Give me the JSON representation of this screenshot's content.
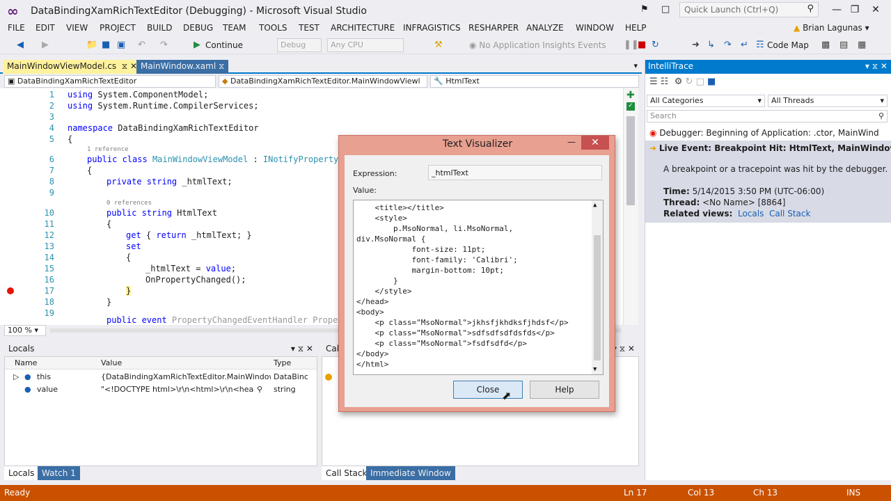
{
  "window": {
    "title": "DataBindingXamRichTextEditor (Debugging) - Microsoft Visual Studio",
    "quick_launch_placeholder": "Quick Launch (Ctrl+Q)"
  },
  "menu": [
    "FILE",
    "EDIT",
    "VIEW",
    "PROJECT",
    "BUILD",
    "DEBUG",
    "TEAM",
    "TOOLS",
    "TEST",
    "ARCHITECTURE",
    "INFRAGISTICS",
    "RESHARPER",
    "ANALYZE",
    "WINDOW",
    "HELP"
  ],
  "user": "Brian Lagunas",
  "toolbar": {
    "continue_label": "Continue",
    "config": "Debug",
    "platform": "Any CPU",
    "insights": "No Application Insights Events",
    "code_map": "Code Map"
  },
  "tabs": {
    "active": "MainWindowViewModel.cs",
    "inactive": "MainWindow.xaml"
  },
  "nav": {
    "project": "DataBindingXamRichTextEditor",
    "type": "DataBindingXamRichTextEditor.MainWindowViewl",
    "member": "HtmlText"
  },
  "editor": {
    "zoom": "100 %",
    "line_numbers": [
      "1",
      "2",
      "3",
      "4",
      "5",
      "6",
      "7",
      "8",
      "9",
      "10",
      "11",
      "12",
      "13",
      "14",
      "15",
      "16",
      "17",
      "18",
      "19"
    ],
    "refs_1": "1 reference",
    "refs_0": "0 references"
  },
  "locals": {
    "title": "Locals",
    "headers": [
      "Name",
      "Value",
      "Type"
    ],
    "rows": [
      {
        "name": "this",
        "value": "{DataBindingXamRichTextEditor.MainWindow",
        "type": "DataBinc"
      },
      {
        "name": "value",
        "value": "\"<!DOCTYPE html>\\r\\n<html>\\r\\n<heac",
        "type": "string"
      }
    ],
    "tab_locals": "Locals",
    "tab_watch": "Watch 1"
  },
  "callstack": {
    "title": "Call",
    "tab_callstack": "Call Stack",
    "tab_immediate": "Immediate Window"
  },
  "intellitrace": {
    "title": "IntelliTrace",
    "categories": "All Categories",
    "threads": "All Threads",
    "search_placeholder": "Search",
    "event1": "Debugger: Beginning of Application: .ctor, MainWind",
    "event2": "Live Event: Breakpoint Hit: HtmlText, MainWindowVie",
    "event2_desc": "A breakpoint or a tracepoint was hit by the debugger.",
    "time_label": "Time:",
    "time_value": "5/14/2015 3:50 PM (UTC-06:00)",
    "thread_label": "Thread:",
    "thread_value": "<No Name> [8864]",
    "related_label": "Related views:",
    "related_locals": "Locals",
    "related_callstack": "Call Stack"
  },
  "dialog": {
    "title": "Text Visualizer",
    "expression_label": "Expression:",
    "expression_value": "_htmlText",
    "value_label": "Value:",
    "lines": [
      "    <title></title>",
      "    <style>",
      "        p.MsoNormal, li.MsoNormal,",
      "div.MsoNormal {",
      "            font-size: 11pt;",
      "            font-family: 'Calibri';",
      "            margin-bottom: 10pt;",
      "        }",
      "    </style>",
      "</head>",
      "<body>",
      "    <p class=\"MsoNormal\">jkhsfjkhdksfjhdsf</p>",
      "    <p class=\"MsoNormal\">sdfsdfsdfdsfds</p>",
      "    <p class=\"MsoNormal\">fsdfsdfd</p>",
      "</body>",
      "</html>"
    ],
    "close_label": "Close",
    "help_label": "Help"
  },
  "status": {
    "ready": "Ready",
    "ln": "Ln 17",
    "col": "Col 13",
    "ch": "Ch 13",
    "ins": "INS"
  },
  "colors": {
    "accent": "#007acc",
    "status_debug": "#ca5100",
    "active_tab": "#fff29d",
    "dialog_border": "#e8a090"
  }
}
